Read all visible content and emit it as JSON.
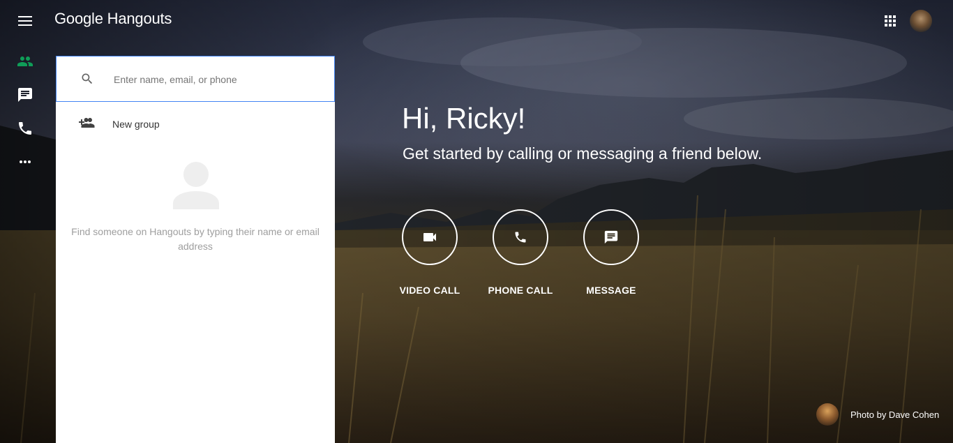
{
  "app": {
    "title": "Google Hangouts"
  },
  "topbar": {
    "menu_icon": "hamburger-menu-icon",
    "apps_icon": "apps-grid-icon",
    "account_icon": "account-avatar"
  },
  "rail": {
    "items": [
      {
        "name": "contacts",
        "icon": "people-icon",
        "color": "#0f9d58"
      },
      {
        "name": "conversations",
        "icon": "chat-icon",
        "color": "#ffffff"
      },
      {
        "name": "phone-calls",
        "icon": "phone-icon",
        "color": "#ffffff"
      },
      {
        "name": "more",
        "icon": "more-horiz-icon",
        "color": "#ffffff"
      }
    ]
  },
  "panel": {
    "search": {
      "placeholder": "Enter name, email, or phone",
      "value": ""
    },
    "new_group_label": "New group",
    "empty_text": "Find someone on Hangouts by typing their name or email address"
  },
  "hero": {
    "greeting": "Hi, Ricky!",
    "subtitle": "Get started by calling or messaging a friend below.",
    "actions": [
      {
        "label": "VIDEO CALL",
        "icon": "videocam-icon"
      },
      {
        "label": "PHONE CALL",
        "icon": "phone-icon"
      },
      {
        "label": "MESSAGE",
        "icon": "message-icon"
      }
    ]
  },
  "credit": {
    "text": "Photo by Dave Cohen"
  },
  "colors": {
    "accent": "#4285f4",
    "contacts_active": "#0f9d58",
    "panel_bg": "#ffffff"
  }
}
